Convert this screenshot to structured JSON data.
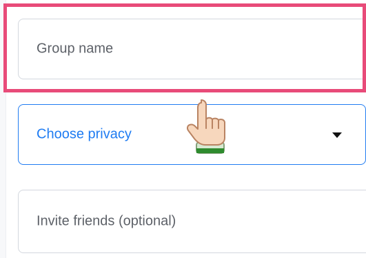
{
  "form": {
    "group_name": {
      "placeholder": "Group name"
    },
    "privacy": {
      "selected_label": "Choose privacy",
      "icons": {
        "dropdown_icon": "caret-down-icon"
      }
    },
    "invite_friends": {
      "placeholder": "Invite friends (optional)"
    }
  },
  "overlay": {
    "highlight_color": "#e84b79",
    "cursor_icon": "pointing-hand-icon"
  },
  "colors": {
    "accent": "#1f7cf2",
    "border": "#d3d7de",
    "placeholder": "#5d6168"
  }
}
